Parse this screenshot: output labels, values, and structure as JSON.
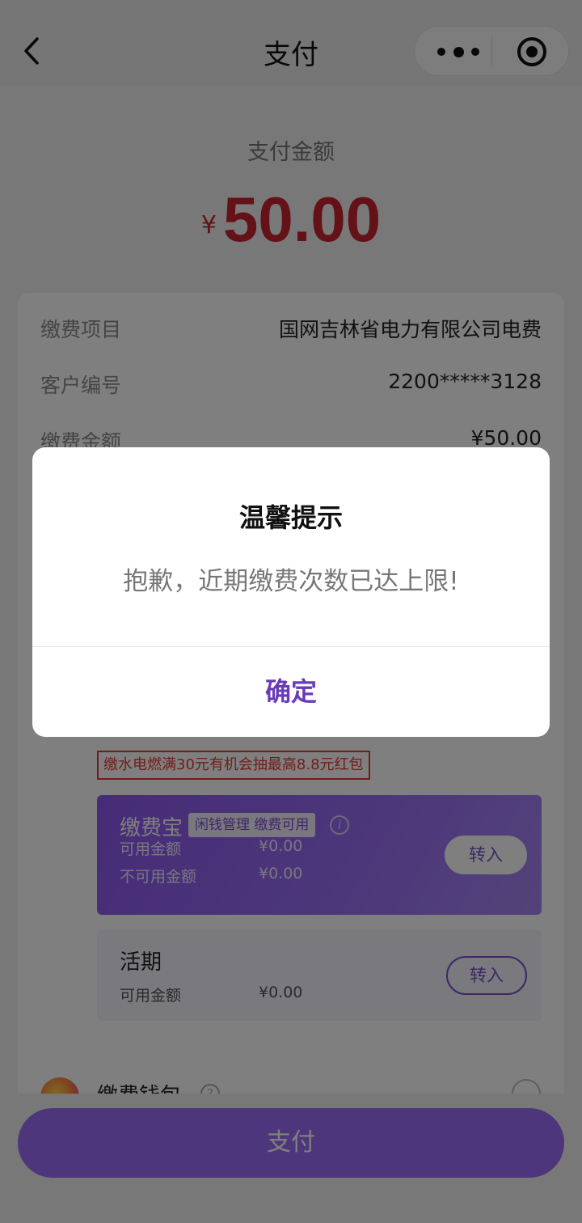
{
  "header": {
    "title": "支付"
  },
  "amount": {
    "label": "支付金额",
    "currency": "¥",
    "value": "50.00"
  },
  "details": [
    {
      "key": "缴费项目",
      "value": "国网吉林省电力有限公司电费"
    },
    {
      "key": "客户编号",
      "value": "2200*****3128"
    },
    {
      "key": "缴费金额",
      "value": "¥50.00"
    }
  ],
  "promo": "缴水电燃满30元有机会抽最高8.8元红包",
  "jiaofeibao": {
    "name": "缴费宝",
    "tag": "闲钱管理 缴费可用",
    "available_label": "可用金额",
    "available_value": "¥0.00",
    "unavailable_label": "不可用金额",
    "unavailable_value": "¥0.00",
    "button": "转入"
  },
  "huoqi": {
    "name": "活期",
    "available_label": "可用金额",
    "available_value": "¥0.00",
    "button": "转入"
  },
  "wallet": {
    "name": "缴费钱包",
    "help": "?"
  },
  "pay_button": "支付",
  "dialog": {
    "title": "温馨提示",
    "message": "抱歉，近期缴费次数已达上限!",
    "confirm": "确定"
  },
  "colors": {
    "accent": "#9b6df6",
    "amount_red": "#c8232f",
    "dialog_button": "#6a3bb8"
  }
}
